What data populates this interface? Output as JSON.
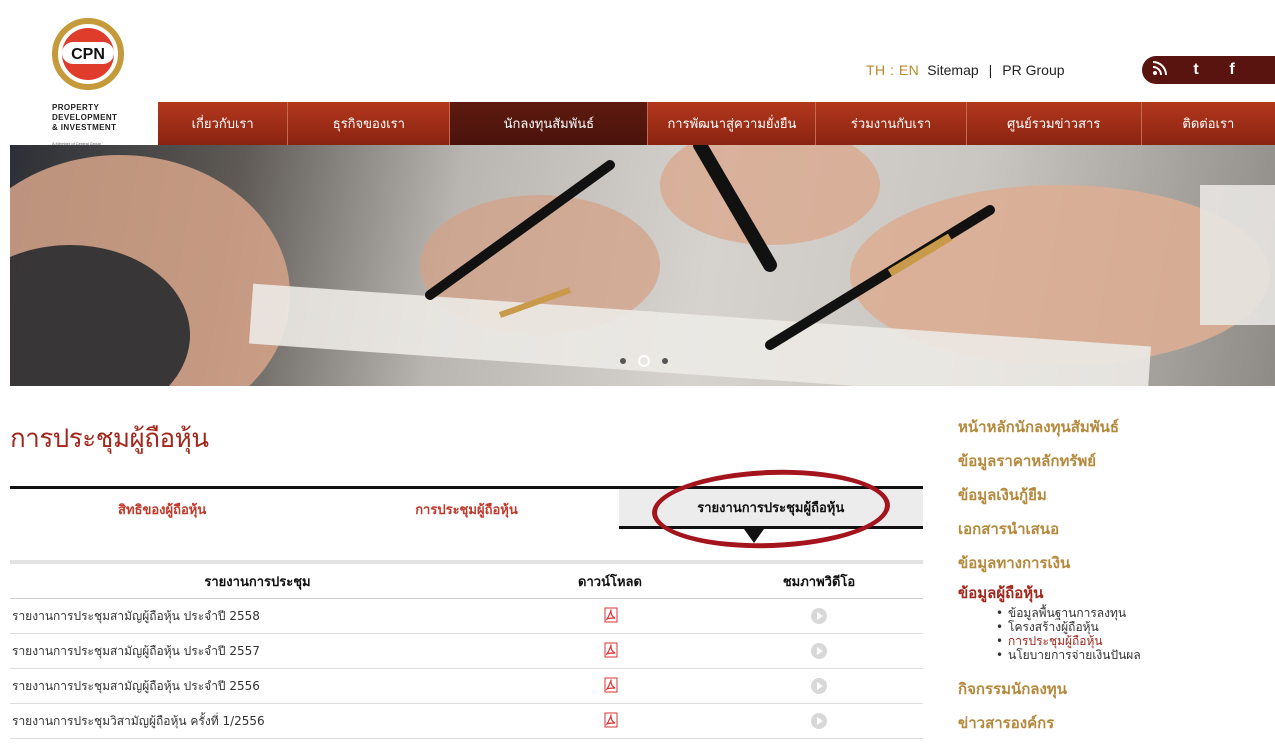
{
  "logo": {
    "mark": "CPN",
    "line1": "PROPERTY",
    "line2": "DEVELOPMENT",
    "line3": "& INVESTMENT",
    "tagline": "A Member of Central Group"
  },
  "toplinks": {
    "lang": "TH : EN",
    "sitemap": "Sitemap",
    "separator": "|",
    "pr_group": "PR Group"
  },
  "social": [
    {
      "icon": "rss-icon",
      "glyph": "ह"
    },
    {
      "icon": "twitter-icon",
      "glyph": "t"
    },
    {
      "icon": "facebook-icon",
      "glyph": "f"
    }
  ],
  "nav": {
    "items": [
      {
        "label": "เกี่ยวกับเรา"
      },
      {
        "label": "ธุรกิจของเรา"
      },
      {
        "label": "นักลงทุนสัมพันธ์"
      },
      {
        "label": "การพัฒนาสู่ความยั่งยืน"
      },
      {
        "label": "ร่วมงานกับเรา"
      },
      {
        "label": "ศูนย์รวมข่าวสาร"
      },
      {
        "label": "ติดต่อเรา"
      }
    ],
    "active_index": 2
  },
  "hero": {
    "slides": 3,
    "active_slide": 2
  },
  "page_title": "การประชุมผู้ถือหุ้น",
  "tabs": [
    {
      "label": "สิทธิของผู้ถือหุ้น"
    },
    {
      "label": "การประชุมผู้ถือหุ้น"
    },
    {
      "label": "รายงานการประชุมผู้ถือหุ้น"
    }
  ],
  "active_tab": 2,
  "table": {
    "headers": [
      "รายงานการประชุม",
      "ดาวน์โหลด",
      "ชมภาพวิดีโอ"
    ],
    "rows": [
      {
        "title": "รายงานการประชุมสามัญผู้ถือหุ้น ประจำปี 2558"
      },
      {
        "title": "รายงานการประชุมสามัญผู้ถือหุ้น ประจำปี 2557"
      },
      {
        "title": "รายงานการประชุมสามัญผู้ถือหุ้น ประจำปี 2556"
      },
      {
        "title": "รายงานการประชุมวิสามัญผู้ถือหุ้น ครั้งที่ 1/2556"
      }
    ]
  },
  "sidebar": {
    "items": [
      {
        "label": "หน้าหลักนักลงทุนสัมพันธ์"
      },
      {
        "label": "ข้อมูลราคาหลักทรัพย์"
      },
      {
        "label": "ข้อมูลเงินกู้ยืม"
      },
      {
        "label": "เอกสารนำเสนอ"
      },
      {
        "label": "ข้อมูลทางการเงิน"
      },
      {
        "label": "ข้อมูลผู้ถือหุ้น"
      },
      {
        "label": "กิจกรรมนักลงทุน"
      },
      {
        "label": "ข่าวสารองค์กร"
      }
    ],
    "active_index": 5,
    "sub_items": [
      {
        "label": "ข้อมูลพื้นฐานการลงทุน"
      },
      {
        "label": "โครงสร้างผู้ถือหุ้น"
      },
      {
        "label": "การประชุมผู้ถือหุ้น"
      },
      {
        "label": "นโยบายการจ่ายเงินปันผล"
      }
    ],
    "active_sub_index": 2
  },
  "colors": {
    "brand_red": "#a1261b",
    "nav_red": "#b3381c",
    "nav_active": "#4a130b",
    "gold": "#b5893c",
    "highlight_ellipse": "#a3141c"
  }
}
